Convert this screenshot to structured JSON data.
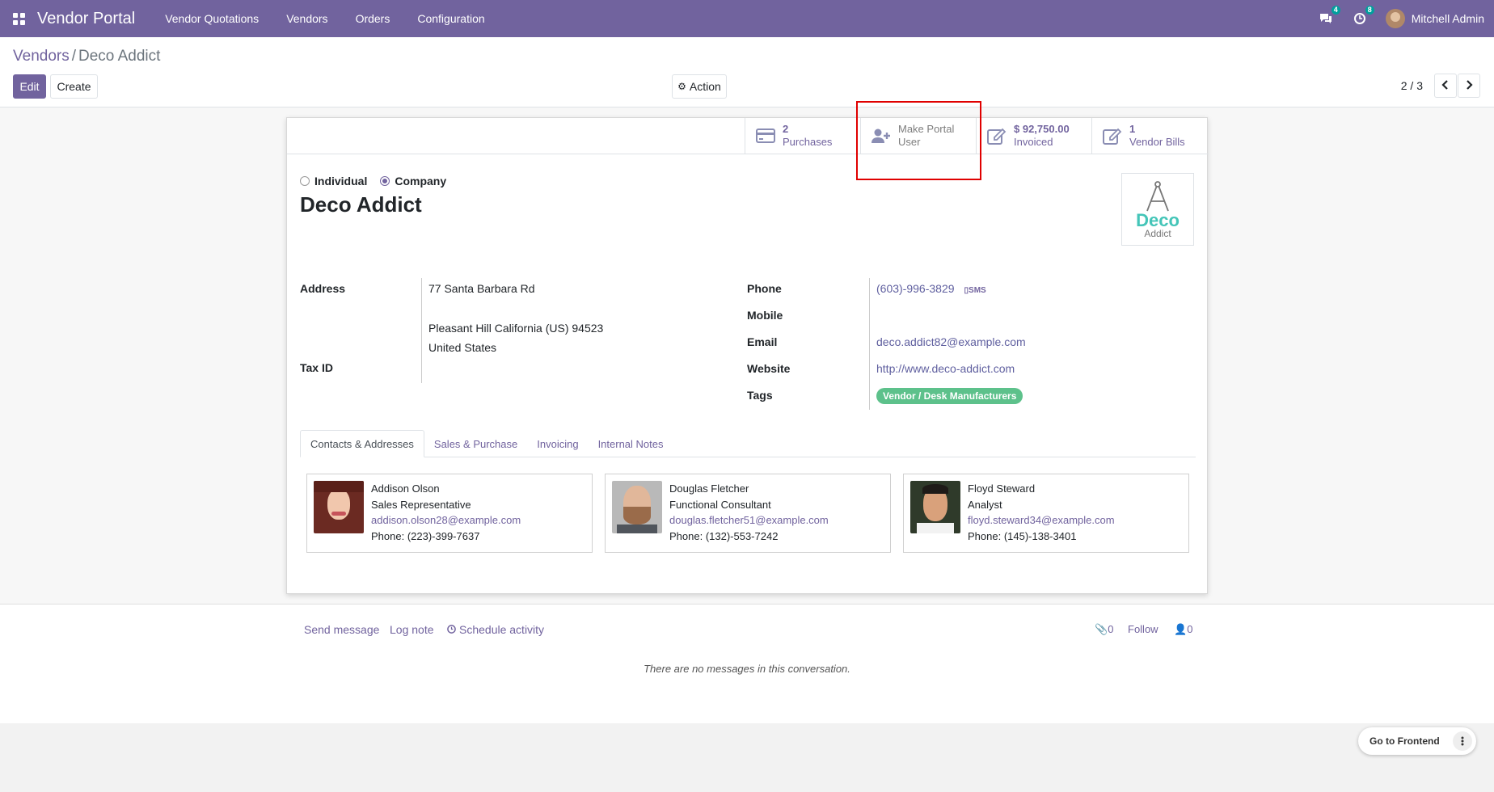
{
  "navbar": {
    "brand": "Vendor Portal",
    "menu": [
      "Vendor Quotations",
      "Vendors",
      "Orders",
      "Configuration"
    ],
    "messages_count": "4",
    "activities_count": "8",
    "user_name": "Mitchell Admin"
  },
  "breadcrumb": {
    "parent": "Vendors",
    "separator": "/",
    "current": "Deco Addict"
  },
  "toolbar": {
    "edit_label": "Edit",
    "create_label": "Create",
    "action_label": "Action"
  },
  "pager": {
    "value": "2 / 3"
  },
  "button_box": {
    "purchases": {
      "value": "2",
      "label": "Purchases"
    },
    "portal": {
      "line1": "Make Portal",
      "line2": "User"
    },
    "invoiced": {
      "value": "$ 92,750.00",
      "label": "Invoiced"
    },
    "vendor_bills": {
      "value": "1",
      "label": "Vendor Bills"
    }
  },
  "company_type": {
    "individual": "Individual",
    "company": "Company",
    "selected": "Company"
  },
  "partner": {
    "name": "Deco Addict",
    "logo_line1": "Deco",
    "logo_line2": "Addict"
  },
  "fields": {
    "address_label": "Address",
    "street": "77 Santa Barbara Rd",
    "city_line": "Pleasant Hill  California (US)  94523",
    "country": "United States",
    "tax_id_label": "Tax ID",
    "phone_label": "Phone",
    "phone": "(603)-996-3829",
    "sms_label": "SMS",
    "mobile_label": "Mobile",
    "email_label": "Email",
    "email": "deco.addict82@example.com",
    "website_label": "Website",
    "website": "http://www.deco-addict.com",
    "tags_label": "Tags",
    "tag": "Vendor / Desk Manufacturers"
  },
  "tabs": [
    "Contacts & Addresses",
    "Sales & Purchase",
    "Invoicing",
    "Internal Notes"
  ],
  "contacts": [
    {
      "name": "Addison Olson",
      "title": "Sales Representative",
      "email": "addison.olson28@example.com",
      "phone": "Phone: (223)-399-7637"
    },
    {
      "name": "Douglas Fletcher",
      "title": "Functional Consultant",
      "email": "douglas.fletcher51@example.com",
      "phone": "Phone: (132)-553-7242"
    },
    {
      "name": "Floyd Steward",
      "title": "Analyst",
      "email": "floyd.steward34@example.com",
      "phone": "Phone: (145)-138-3401"
    }
  ],
  "chatter": {
    "send_message": "Send message",
    "log_note": "Log note",
    "schedule_activity": "Schedule activity",
    "attachments_count": "0",
    "follow": "Follow",
    "followers_count": "0",
    "empty_text": "There are no messages in this conversation."
  },
  "frontend": {
    "label": "Go to Frontend"
  },
  "colors": {
    "brand": "#71639e",
    "tag": "#5dc18b",
    "highlight": "#e00000"
  }
}
